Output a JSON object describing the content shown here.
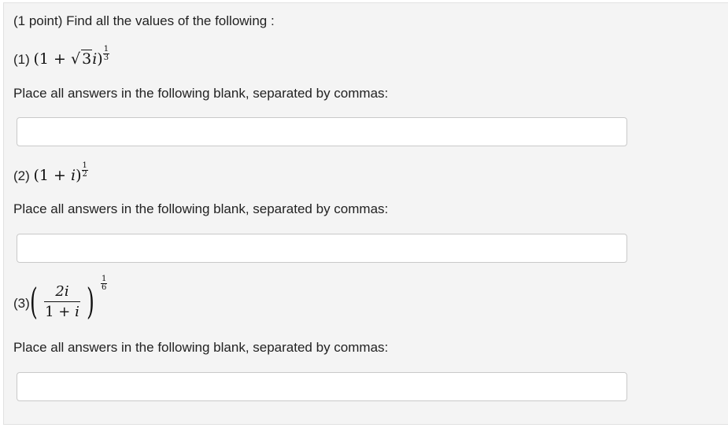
{
  "header": "(1 point) Find all the values of the following :",
  "questions": [
    {
      "number": "(1)",
      "base": "(1 + √3i)",
      "exp_num": "1",
      "exp_den": "3",
      "prompt": "Place all answers in the following blank, separated by commas:",
      "value": ""
    },
    {
      "number": "(2)",
      "base": "(1 + i)",
      "exp_num": "1",
      "exp_den": "2",
      "prompt": "Place all answers in the following blank, separated by commas:",
      "value": ""
    },
    {
      "number": "(3)",
      "frac_num": "2i",
      "frac_den": "1 + i",
      "exp_num": "1",
      "exp_den": "6",
      "prompt": "Place all answers in the following blank, separated by commas:",
      "value": ""
    }
  ]
}
